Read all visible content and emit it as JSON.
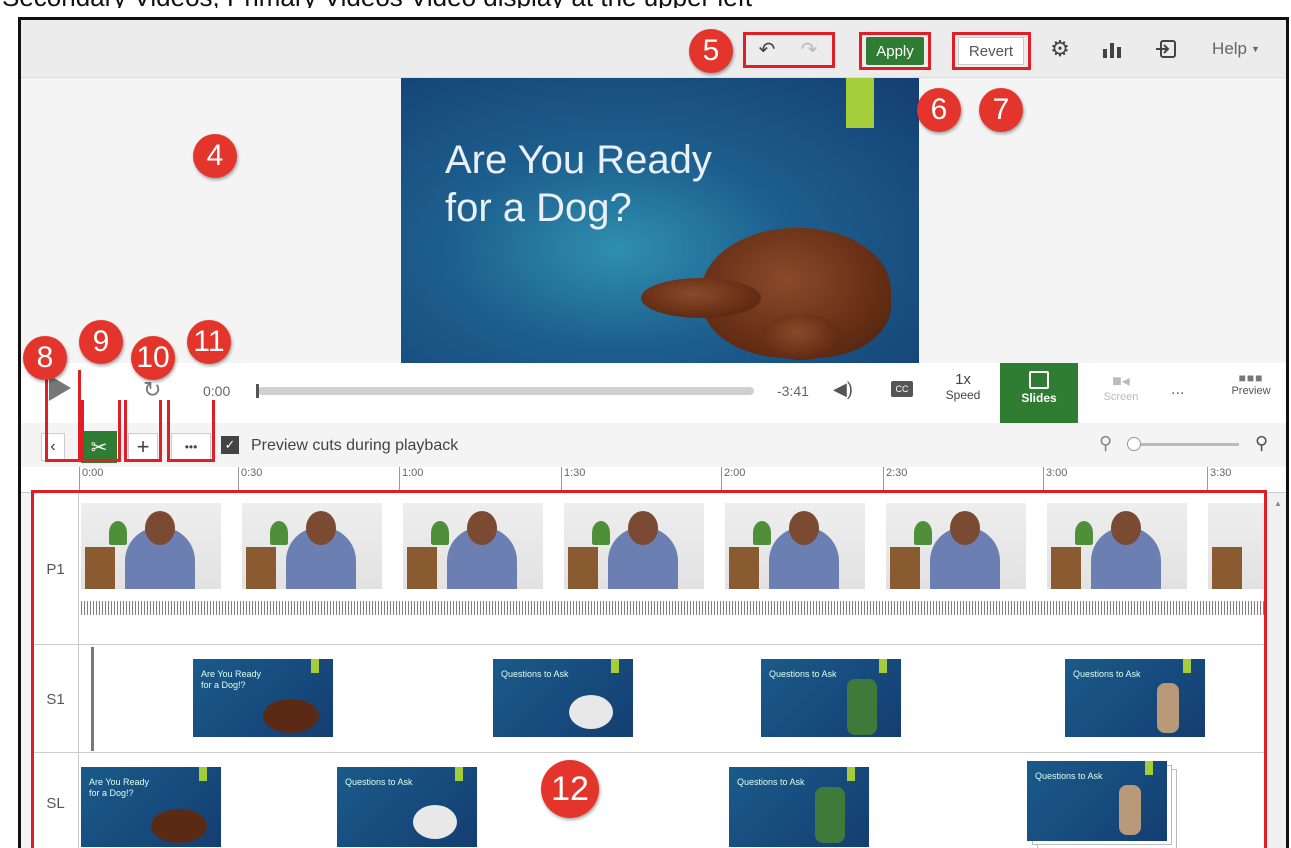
{
  "caption": "Secondary Videos, Primary Videos  Video display at the upper left",
  "topbar": {
    "apply_label": "Apply",
    "revert_label": "Revert",
    "help_label": "Help"
  },
  "callouts": [
    "4",
    "5",
    "6",
    "7",
    "8",
    "9",
    "10",
    "11",
    "12"
  ],
  "slide": {
    "title": "Are You Ready\nfor a Dog?"
  },
  "controls": {
    "time": "0:00",
    "remaining": "-3:41",
    "cc": "CC",
    "speed_value": "1x",
    "speed_label": "Speed",
    "slides_label": "Slides",
    "screen_label": "Screen",
    "more_label": "...",
    "preview_label": "Preview",
    "progress": 0.0
  },
  "tools": {
    "more": "•••",
    "preview_cuts_label": "Preview cuts during playback",
    "preview_cuts_checked": true
  },
  "ruler": {
    "ticks": [
      "0:00",
      "0:30",
      "1:00",
      "1:30",
      "2:00",
      "2:30",
      "3:00",
      "3:30"
    ]
  },
  "lanes": {
    "p1": "P1",
    "s1": "S1",
    "sl": "SL"
  },
  "mini_slides": {
    "s1": [
      "Are You Ready\nfor a Dog!?",
      "Questions to Ask",
      "Questions to Ask",
      "Questions to Ask"
    ],
    "sl": [
      "Are You Ready\nfor a Dog!?",
      "Questions to Ask",
      "Questions to Ask",
      "Questions to Ask"
    ]
  },
  "colors": {
    "apply_bg": "#2f7d32",
    "slides_bg": "#2f7d32",
    "callout_red": "#e4352d",
    "box_red": "#e01e26",
    "accent_green": "#a4cd39"
  }
}
